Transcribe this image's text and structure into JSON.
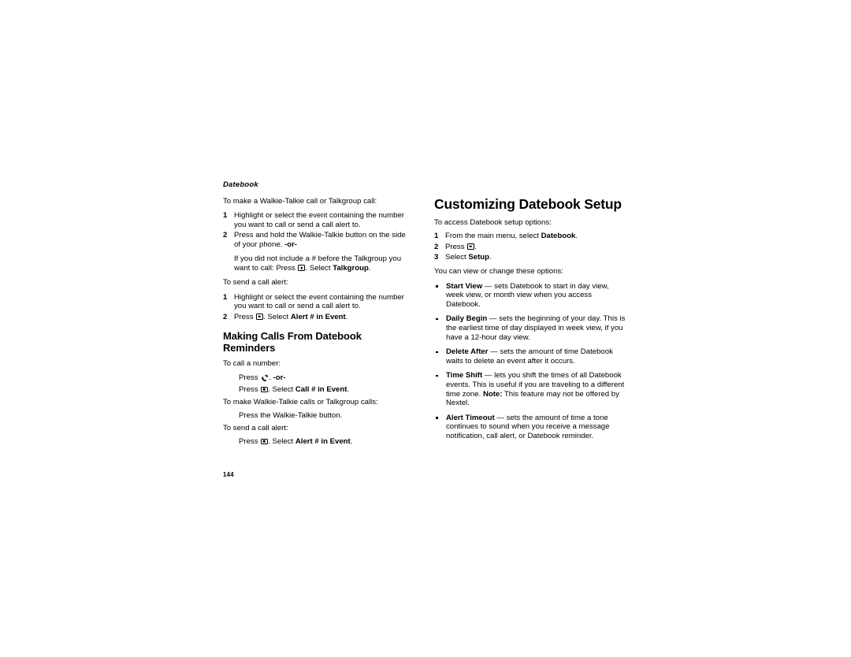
{
  "page": {
    "running_head": "Datebook",
    "folio": "144",
    "background": "#ffffff",
    "text_color": "#000000"
  },
  "icons": {
    "menu_select_key": "menu-select-key-icon",
    "call_key": "call-key-icon"
  },
  "left_column": {
    "intro_1": "To make a Walkie-Talkie call or Talkgroup call:",
    "steps_1": [
      {
        "num": "1",
        "text": "Highlight or select the event containing the number you want to call or send a call alert to."
      },
      {
        "num": "2",
        "text_before": "Press and hold the Walkie-Talkie button on the side of your phone. ",
        "bold_tail": "-or-"
      }
    ],
    "continuation_1_before": "If you did not include a # before the Talkgroup you want to call: Press ",
    "continuation_1_mid": ". Select ",
    "continuation_1_bold": "Talkgroup",
    "continuation_1_end": ".",
    "intro_2": "To send a call alert:",
    "steps_2": [
      {
        "num": "1",
        "text": "Highlight or select the event containing the number you want to call or send a call alert to."
      }
    ],
    "step_2b": {
      "num": "2",
      "before": "Press ",
      "mid": ". Select ",
      "bold": "Alert # in Event",
      "end": "."
    },
    "heading": "Making Calls From Datebook Reminders",
    "intro_3": "To call a number:",
    "press_call": {
      "before": "Press ",
      "after": ". ",
      "bold": "-or-"
    },
    "press_call_menu": {
      "before": "Press ",
      "mid": ". Select ",
      "bold": "Call # in Event",
      "end": "."
    },
    "intro_4": "To make Walkie-Talkie calls or Talkgroup calls:",
    "press_wt": "Press the Walkie-Talkie button.",
    "intro_5": "To send a call alert:",
    "press_alert": {
      "before": "Press ",
      "mid": ". Select ",
      "bold": "Alert # in Event",
      "end": "."
    }
  },
  "right_column": {
    "heading": "Customizing Datebook Setup",
    "intro": "To access Datebook setup options:",
    "steps": [
      {
        "num": "1",
        "before": "From the main menu, select ",
        "bold": "Datebook",
        "end": "."
      },
      {
        "num": "2",
        "before": "Press ",
        "bold": "",
        "end": "."
      },
      {
        "num": "3",
        "before": "Select ",
        "bold": "Setup",
        "end": "."
      }
    ],
    "options_intro": "You can view or change these options:",
    "options": [
      {
        "term": "Start View",
        "body": " — sets Datebook to start in day view, week view, or month view when you access Datebook."
      },
      {
        "term": "Daily Begin",
        "body": " — sets the beginning of your day. This is the earliest time of day displayed in week view, if you have a 12-hour day view."
      },
      {
        "term": "Delete After",
        "body": " — sets the amount of time Datebook waits to delete an event after it occurs."
      },
      {
        "term": "Time Shift",
        "body": " — lets you shift the times of all Datebook events. This is useful if you are traveling to a different time zone.",
        "note_label": "Note:",
        "note_text": " This feature may not be offered by Nextel."
      },
      {
        "term": "Alert Timeout",
        "body": " — sets the amount of time a tone continues to sound when you receive a message notification, call alert, or Datebook reminder."
      }
    ]
  }
}
